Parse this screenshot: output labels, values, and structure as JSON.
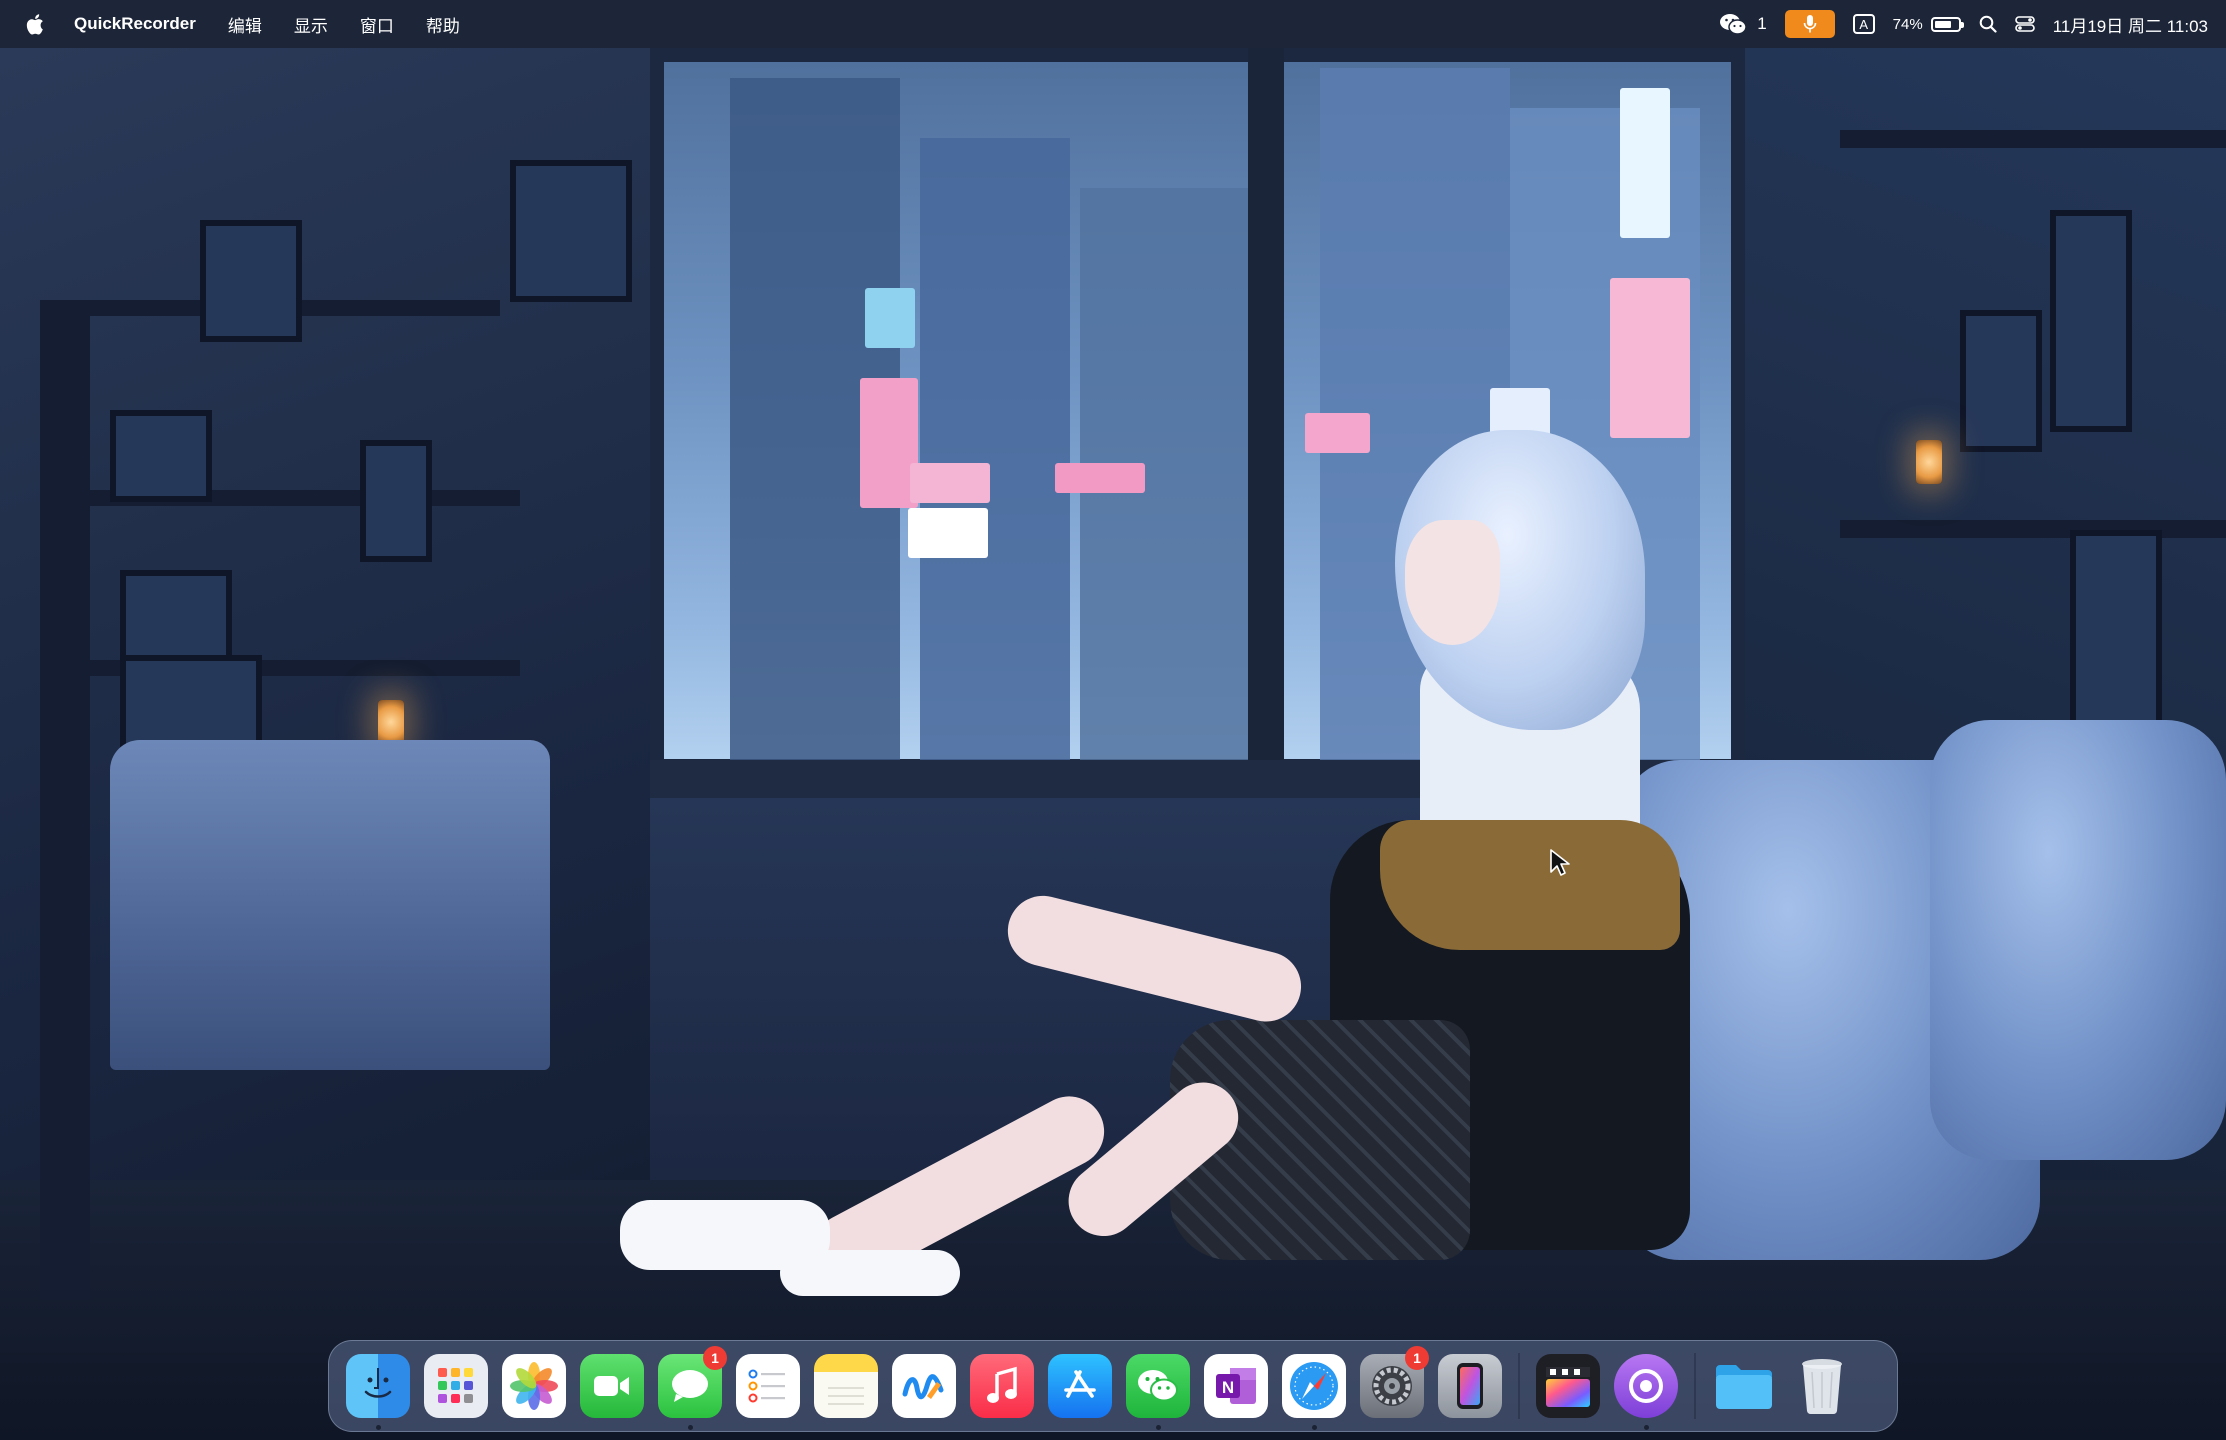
{
  "menubar": {
    "app_name": "QuickRecorder",
    "menus": [
      "编辑",
      "显示",
      "窗口",
      "帮助"
    ],
    "status": {
      "wechat_count": "1",
      "input_method": "A",
      "battery_percent": "74%",
      "battery_level": 0.74,
      "datetime": "11月19日 周二 11:03",
      "mic_color": "#f08a1c"
    }
  },
  "dock": {
    "apps": [
      {
        "name": "Finder",
        "icon": "finder-icon",
        "running": true,
        "badge": ""
      },
      {
        "name": "Launchpad",
        "icon": "launchpad-icon",
        "running": false,
        "badge": ""
      },
      {
        "name": "Photos",
        "icon": "photos-icon",
        "running": false,
        "badge": ""
      },
      {
        "name": "FaceTime",
        "icon": "facetime-icon",
        "running": false,
        "badge": ""
      },
      {
        "name": "Messages",
        "icon": "messages-icon",
        "running": true,
        "badge": "1"
      },
      {
        "name": "Reminders",
        "icon": "reminders-icon",
        "running": false,
        "badge": ""
      },
      {
        "name": "Notes",
        "icon": "notes-icon",
        "running": false,
        "badge": ""
      },
      {
        "name": "Freeform",
        "icon": "freeform-icon",
        "running": false,
        "badge": ""
      },
      {
        "name": "Music",
        "icon": "music-icon",
        "running": false,
        "badge": ""
      },
      {
        "name": "App Store",
        "icon": "app-store-icon",
        "running": false,
        "badge": ""
      },
      {
        "name": "WeChat",
        "icon": "wechat-icon",
        "running": true,
        "badge": ""
      },
      {
        "name": "OneNote",
        "icon": "onenote-icon",
        "running": false,
        "badge": ""
      },
      {
        "name": "Safari",
        "icon": "safari-icon",
        "running": true,
        "badge": ""
      },
      {
        "name": "System Settings",
        "icon": "system-settings-icon",
        "running": false,
        "badge": "1"
      },
      {
        "name": "iPhone Mirroring",
        "icon": "iphone-mirroring-icon",
        "running": false,
        "badge": ""
      }
    ],
    "extra_apps": [
      {
        "name": "Final Cut Pro",
        "icon": "final-cut-icon",
        "running": false,
        "badge": ""
      },
      {
        "name": "QuickRecorder",
        "icon": "quickrecorder-icon",
        "running": true,
        "badge": ""
      }
    ],
    "folders": [
      {
        "name": "Downloads",
        "icon": "folder-icon"
      },
      {
        "name": "Trash",
        "icon": "trash-icon"
      }
    ]
  },
  "colors": {
    "menubar_bg": "#1d2638",
    "badge_red": "#ee3b34",
    "dock_bg": "rgba(95,112,148,.55)"
  }
}
